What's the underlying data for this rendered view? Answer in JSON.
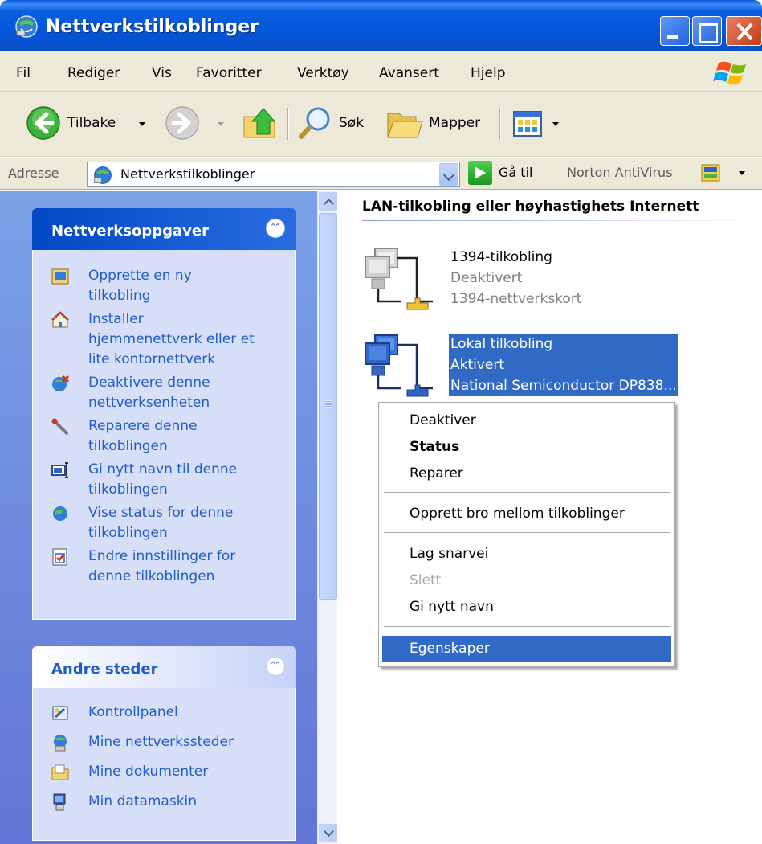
{
  "window": {
    "title": "Nettverkstilkoblinger"
  },
  "menubar": {
    "items": [
      "Fil",
      "Rediger",
      "Vis",
      "Favoritter",
      "Verktøy",
      "Avansert",
      "Hjelp"
    ]
  },
  "toolbar": {
    "back_label": "Tilbake",
    "search_label": "Søk",
    "folders_label": "Mapper"
  },
  "addressbar": {
    "label": "Adresse",
    "value": "Nettverkstilkoblinger",
    "go_label": "Gå til",
    "norton_label": "Norton AntiVirus"
  },
  "taskpane": {
    "network_tasks": {
      "title": "Nettverksoppgaver",
      "items": [
        {
          "label": "Opprette en ny\ntilkobling",
          "icon": "new-connection-icon"
        },
        {
          "label": "Installer\nhjemmenettverk eller et\nlite kontornettverk",
          "icon": "home-network-icon"
        },
        {
          "label": "Deaktivere denne\nnettverksenheten",
          "icon": "disable-device-icon"
        },
        {
          "label": "Reparere denne\ntilkoblingen",
          "icon": "repair-wrench-icon"
        },
        {
          "label": "Gi nytt navn til denne\ntilkoblingen",
          "icon": "rename-icon"
        },
        {
          "label": "Vise status for denne\ntilkoblingen",
          "icon": "status-globe-icon"
        },
        {
          "label": "Endre innstillinger for\ndenne tilkoblingen",
          "icon": "settings-check-icon"
        }
      ]
    },
    "other_places": {
      "title": "Andre steder",
      "items": [
        {
          "label": "Kontrollpanel",
          "icon": "control-panel-icon"
        },
        {
          "label": "Mine nettverkssteder",
          "icon": "network-places-icon"
        },
        {
          "label": "Mine dokumenter",
          "icon": "my-documents-icon"
        },
        {
          "label": "Min datamaskin",
          "icon": "my-computer-icon"
        }
      ]
    }
  },
  "content": {
    "group_heading": "LAN-tilkobling eller høyhastighets Internett",
    "connections": [
      {
        "name": "1394-tilkobling",
        "status": "Deaktivert",
        "device": "1394-nettverkskort",
        "selected": false
      },
      {
        "name": "Lokal tilkobling",
        "status": "Aktivert",
        "device": "National Semiconductor DP838...",
        "selected": true
      }
    ]
  },
  "context_menu": {
    "items": [
      {
        "label": "Deaktiver"
      },
      {
        "label": "Status",
        "bold": true
      },
      {
        "label": "Reparer"
      },
      {
        "label": "Opprett bro mellom tilkoblinger"
      },
      {
        "label": "Lag snarvei"
      },
      {
        "label": "Slett",
        "disabled": true
      },
      {
        "label": "Gi nytt navn"
      },
      {
        "label": "Egenskaper",
        "highlighted": true
      }
    ]
  },
  "colors": {
    "title_blue": "#0554d6",
    "selection_blue": "#316ac5",
    "task_link": "#215dc6",
    "taskpane_bg": "#7ba2e7"
  }
}
